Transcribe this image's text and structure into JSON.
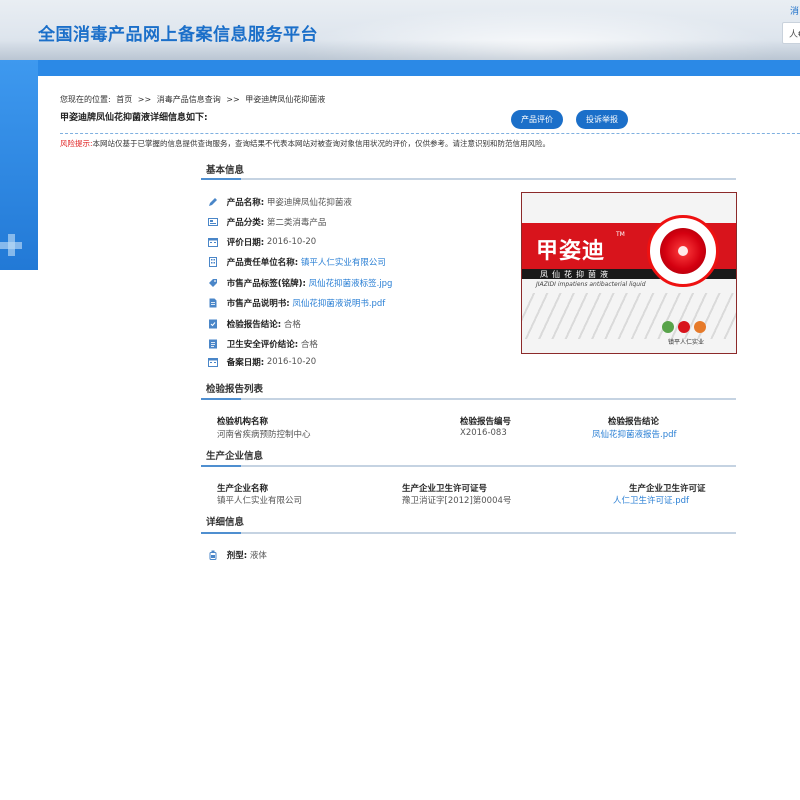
{
  "header": {
    "site_title": "全国消毒产品网上备案信息服务平台",
    "search_placeholder": "人€",
    "top_link": "消"
  },
  "breadcrumb": {
    "items": [
      "您现在的位置:",
      "首页",
      ">>",
      "消毒产品信息查询",
      ">>",
      "甲姿迪牌凤仙花抑菌液"
    ]
  },
  "detail_title": "甲姿迪牌凤仙花抑菌液详细信息如下:",
  "buttons": {
    "evaluate": "产品评价",
    "complaint": "投诉举报"
  },
  "risk_note": {
    "label": "风险提示:",
    "text": "本网站仅基于已掌握的信息提供查询服务，查询结果不代表本网站对被查询对象信用状况的评价，仅供参考。请注意识别和防范信用风险。"
  },
  "basic_info": {
    "title": "基本信息",
    "rows": [
      {
        "icon": "pencil-icon",
        "label": "产品名称:",
        "value": "甲姿迪牌凤仙花抑菌液",
        "is_link": false
      },
      {
        "icon": "category-icon",
        "label": "产品分类:",
        "value": "第二类消毒产品",
        "is_link": false
      },
      {
        "icon": "calendar-icon",
        "label": "评价日期:",
        "value": "2016-10-20",
        "is_link": false
      },
      {
        "icon": "building-icon",
        "label": "产品责任单位名称:",
        "value": "镇平人仁实业有限公司",
        "is_link": true
      },
      {
        "icon": "tag-icon",
        "label": "市售产品标签(铭牌):",
        "value": "凤仙花抑菌液标签.jpg",
        "is_link": true
      },
      {
        "icon": "document-icon",
        "label": "市售产品说明书:",
        "value": "凤仙花抑菌液说明书.pdf",
        "is_link": true
      },
      {
        "icon": "report-icon",
        "label": "检验报告结论:",
        "value": "合格",
        "is_link": false
      },
      {
        "icon": "shield-icon",
        "label": "卫生安全评价结论:",
        "value": "合格",
        "is_link": false
      },
      {
        "icon": "calendar-icon",
        "label": "备案日期:",
        "value": "2016-10-20",
        "is_link": false
      }
    ]
  },
  "product_image": {
    "brand": "甲姿迪",
    "tm": "TM",
    "name_cn": "凤仙花抑菌液",
    "name_en": "JIAZIDI impatiens antibacterial liquid",
    "company": "镇平人仁实业"
  },
  "report_list": {
    "title": "检验报告列表",
    "headers": [
      "检验机构名称",
      "检验报告编号",
      "检验报告结论"
    ],
    "rows": [
      {
        "agency": "河南省疾病预防控制中心",
        "report_no": "X2016-083",
        "conclusion": "凤仙花抑菌液报告.pdf"
      }
    ]
  },
  "producer_info": {
    "title": "生产企业信息",
    "headers": [
      "生产企业名称",
      "生产企业卫生许可证号",
      "生产企业卫生许可证"
    ],
    "rows": [
      {
        "name": "镇平人仁实业有限公司",
        "license_no": "豫卫消证字[2012]第0004号",
        "license_file": "人仁卫生许可证.pdf"
      }
    ]
  },
  "detail_info": {
    "title": "详细信息",
    "rows": [
      {
        "icon": "bottle-icon",
        "label": "剂型:",
        "value": "液体"
      }
    ]
  },
  "colors": {
    "brand_blue": "#1b6fc9",
    "band_blue": "#2b89e6",
    "link_blue": "#2a7fd4",
    "risk_red": "#e02020"
  }
}
